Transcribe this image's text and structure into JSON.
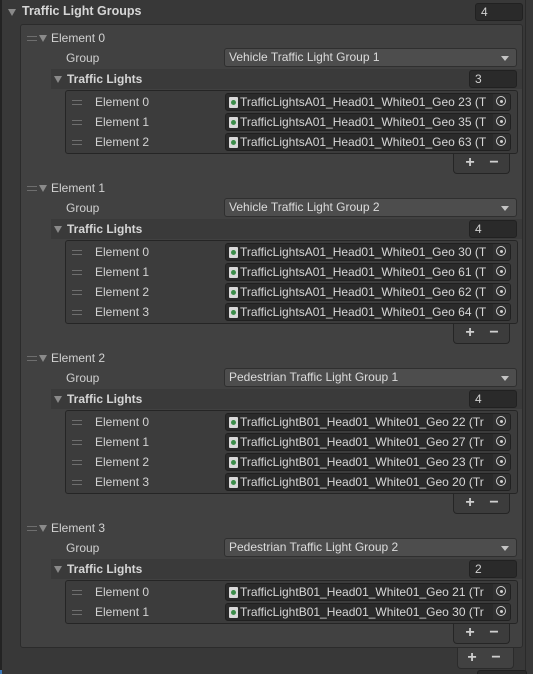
{
  "root": {
    "title": "Traffic Light Groups",
    "count": "4"
  },
  "labels": {
    "group": "Group",
    "traffic_lights": "Traffic Lights",
    "add": "+",
    "remove": "−"
  },
  "elements": [
    {
      "title": "Element 0",
      "group": "Vehicle Traffic Light Group 1",
      "count": "3",
      "lights": [
        {
          "label": "Element 0",
          "value": "TrafficLightsA01_Head01_White01_Geo 23 (T"
        },
        {
          "label": "Element 1",
          "value": "TrafficLightsA01_Head01_White01_Geo 35 (T"
        },
        {
          "label": "Element 2",
          "value": "TrafficLightsA01_Head01_White01_Geo 63 (T"
        }
      ]
    },
    {
      "title": "Element 1",
      "group": "Vehicle Traffic Light Group 2",
      "count": "4",
      "lights": [
        {
          "label": "Element 0",
          "value": "TrafficLightsA01_Head01_White01_Geo 30 (T"
        },
        {
          "label": "Element 1",
          "value": "TrafficLightsA01_Head01_White01_Geo 61 (T"
        },
        {
          "label": "Element 2",
          "value": "TrafficLightsA01_Head01_White01_Geo 62 (T"
        },
        {
          "label": "Element 3",
          "value": "TrafficLightsA01_Head01_White01_Geo 64 (T"
        }
      ]
    },
    {
      "title": "Element 2",
      "group": "Pedestrian Traffic Light Group 1",
      "count": "4",
      "lights": [
        {
          "label": "Element 0",
          "value": "TrafficLightB01_Head01_White01_Geo 22 (Tr"
        },
        {
          "label": "Element 1",
          "value": "TrafficLightB01_Head01_White01_Geo 27 (Tr"
        },
        {
          "label": "Element 2",
          "value": "TrafficLightB01_Head01_White01_Geo 23 (Tr"
        },
        {
          "label": "Element 3",
          "value": "TrafficLightB01_Head01_White01_Geo 20 (Tr"
        }
      ]
    },
    {
      "title": "Element 3",
      "group": "Pedestrian Traffic Light Group 2",
      "count": "2",
      "lights": [
        {
          "label": "Element 0",
          "value": "TrafficLightB01_Head01_White01_Geo 21 (Tr"
        },
        {
          "label": "Element 1",
          "value": "TrafficLightB01_Head01_White01_Geo 30 (Tr"
        }
      ]
    }
  ]
}
